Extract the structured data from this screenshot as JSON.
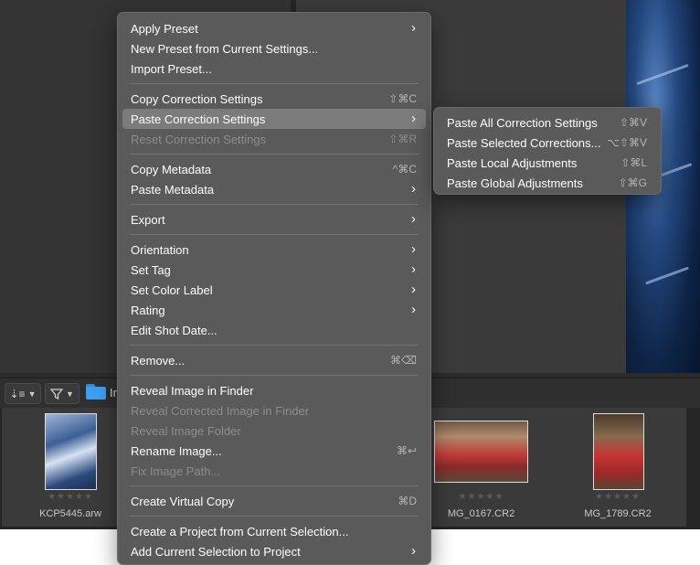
{
  "filmstrip": {
    "files": [
      {
        "name": "KCP5445.arw",
        "stars": "★★★★★"
      },
      {
        "name": "MG_0167.CR2",
        "stars": "★★★★★"
      },
      {
        "name": "MG_1789.CR2",
        "stars": "★★★★★"
      }
    ]
  },
  "toolbar": {
    "path_text": "In"
  },
  "context_menu": {
    "items": [
      {
        "label": "Apply Preset",
        "shortcut": "",
        "submenu": true,
        "disabled": false
      },
      {
        "label": "New Preset from Current Settings...",
        "shortcut": "",
        "submenu": false,
        "disabled": false
      },
      {
        "label": "Import Preset...",
        "shortcut": "",
        "submenu": false,
        "disabled": false
      },
      {
        "label": "Copy Correction Settings",
        "shortcut": "⇧⌘C",
        "submenu": false,
        "disabled": false
      },
      {
        "label": "Paste Correction Settings",
        "shortcut": "",
        "submenu": true,
        "disabled": false
      },
      {
        "label": "Reset Correction Settings",
        "shortcut": "⇧⌘R",
        "submenu": false,
        "disabled": true
      },
      {
        "label": "Copy Metadata",
        "shortcut": "^⌘C",
        "submenu": false,
        "disabled": false
      },
      {
        "label": "Paste Metadata",
        "shortcut": "",
        "submenu": true,
        "disabled": false
      },
      {
        "label": "Export",
        "shortcut": "",
        "submenu": true,
        "disabled": false
      },
      {
        "label": "Orientation",
        "shortcut": "",
        "submenu": true,
        "disabled": false
      },
      {
        "label": "Set Tag",
        "shortcut": "",
        "submenu": true,
        "disabled": false
      },
      {
        "label": "Set Color Label",
        "shortcut": "",
        "submenu": true,
        "disabled": false
      },
      {
        "label": "Rating",
        "shortcut": "",
        "submenu": true,
        "disabled": false
      },
      {
        "label": "Edit Shot Date...",
        "shortcut": "",
        "submenu": false,
        "disabled": false
      },
      {
        "label": "Remove...",
        "shortcut": "⌘⌫",
        "submenu": false,
        "disabled": false
      },
      {
        "label": "Reveal Image in Finder",
        "shortcut": "",
        "submenu": false,
        "disabled": false
      },
      {
        "label": "Reveal Corrected Image in Finder",
        "shortcut": "",
        "submenu": false,
        "disabled": true
      },
      {
        "label": "Reveal Image Folder",
        "shortcut": "",
        "submenu": false,
        "disabled": true
      },
      {
        "label": "Rename Image...",
        "shortcut": "⌘↩",
        "submenu": false,
        "disabled": false
      },
      {
        "label": "Fix Image Path...",
        "shortcut": "",
        "submenu": false,
        "disabled": true
      },
      {
        "label": "Create Virtual Copy",
        "shortcut": "⌘D",
        "submenu": false,
        "disabled": false
      },
      {
        "label": "Create a Project from Current Selection...",
        "shortcut": "",
        "submenu": false,
        "disabled": false
      },
      {
        "label": "Add Current Selection to Project",
        "shortcut": "",
        "submenu": true,
        "disabled": false
      }
    ],
    "highlighted": "Paste Correction Settings"
  },
  "submenu": {
    "items": [
      {
        "label": "Paste All Correction Settings",
        "shortcut": "⇧⌘V"
      },
      {
        "label": "Paste Selected Corrections...",
        "shortcut": "⌥⇧⌘V"
      },
      {
        "label": "Paste Local Adjustments",
        "shortcut": "⇧⌘L"
      },
      {
        "label": "Paste Global Adjustments",
        "shortcut": "⇧⌘G"
      }
    ]
  },
  "icons": {
    "submenu_arrow": "chevron-right-icon",
    "sort": "sort-icon",
    "filter": "filter-icon",
    "folder": "folder-icon"
  },
  "colors": {
    "menu_bg": "#5a5a5a",
    "menu_highlight": "#7b7b7b",
    "folder_blue": "#3aa0ef"
  }
}
